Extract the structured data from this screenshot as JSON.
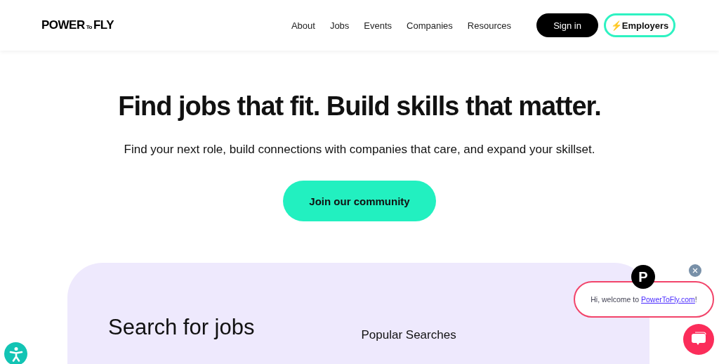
{
  "header": {
    "logo": {
      "main": "POWER",
      "small": "To",
      "end": "FLY"
    },
    "nav": [
      "About",
      "Jobs",
      "Events",
      "Companies",
      "Resources"
    ],
    "sign_in": "Sign in",
    "employers": {
      "icon": "⚡",
      "label": "Employers"
    }
  },
  "hero": {
    "title": "Find jobs that fit. Build skills that matter.",
    "subtitle": "Find your next role, build connections with companies that care, and expand your skillset.",
    "cta": "Join our community"
  },
  "search_card": {
    "title": "Search for jobs",
    "popular_heading": "Popular Searches"
  },
  "chat": {
    "avatar": "P",
    "message": "Hi, welcome to ",
    "link": "PowerToFly.com",
    "after": "!"
  }
}
